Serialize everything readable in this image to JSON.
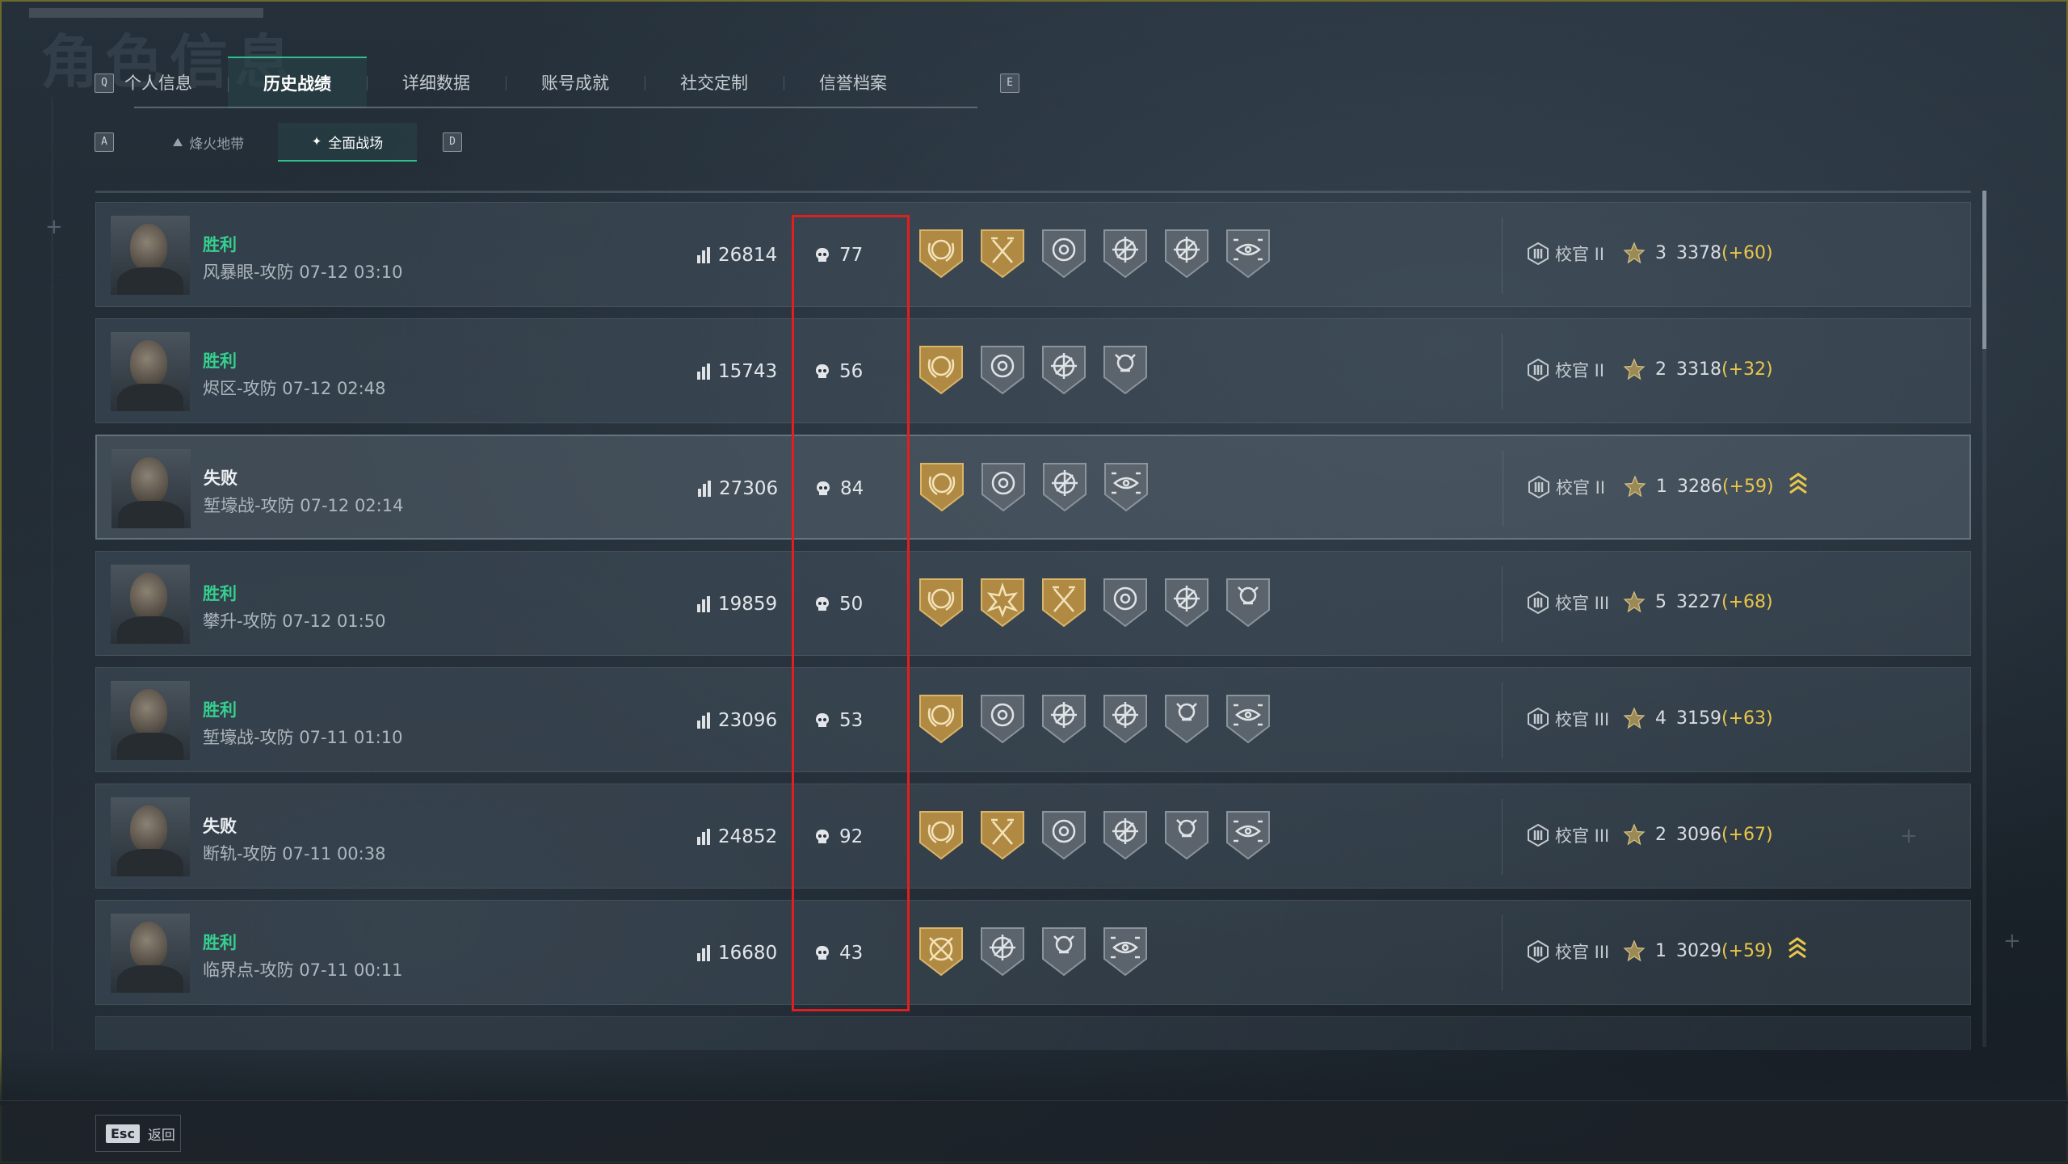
{
  "page_title_bg": "角色信息",
  "keys": {
    "left_tab": "Q",
    "right_tab": "E",
    "left_sub": "A",
    "right_sub": "D"
  },
  "tabs": [
    {
      "label": "个人信息",
      "active": false
    },
    {
      "label": "历史战绩",
      "active": true
    },
    {
      "label": "详细数据",
      "active": false
    },
    {
      "label": "账号成就",
      "active": false
    },
    {
      "label": "社交定制",
      "active": false
    },
    {
      "label": "信誉档案",
      "active": false
    }
  ],
  "subtabs": [
    {
      "label": "烽火地带",
      "icon": "fire-zone-icon",
      "active": false
    },
    {
      "label": "全面战场",
      "icon": "warfare-icon",
      "active": true
    }
  ],
  "matches": [
    {
      "result": "胜利",
      "win": true,
      "map": "风暴眼-攻防 07-12 03:10",
      "score": "26814",
      "kills": "77",
      "medals": [
        "gold-wreath",
        "gold-axes",
        "silver-target",
        "silver-crosshair",
        "silver-crosshair",
        "silver-eye"
      ],
      "rank": "校官 II",
      "stars": "3",
      "points": "3378",
      "delta": "(+60)",
      "promoted": false,
      "highlight": false
    },
    {
      "result": "胜利",
      "win": true,
      "map": "烬区-攻防 07-12 02:48",
      "score": "15743",
      "kills": "56",
      "medals": [
        "gold-wreath",
        "silver-target",
        "silver-crosshair",
        "silver-skull"
      ],
      "rank": "校官 II",
      "stars": "2",
      "points": "3318",
      "delta": "(+32)",
      "promoted": false,
      "highlight": false
    },
    {
      "result": "失败",
      "win": false,
      "map": "堑壕战-攻防 07-12 02:14",
      "score": "27306",
      "kills": "84",
      "medals": [
        "gold-wreath",
        "silver-target",
        "silver-crosshair",
        "silver-eye"
      ],
      "rank": "校官 II",
      "stars": "1",
      "points": "3286",
      "delta": "(+59)",
      "promoted": true,
      "highlight": true
    },
    {
      "result": "胜利",
      "win": true,
      "map": "攀升-攻防 07-12 01:50",
      "score": "19859",
      "kills": "50",
      "medals": [
        "gold-wreath",
        "gold-burst",
        "gold-axes",
        "silver-target",
        "silver-crosshair",
        "silver-skull"
      ],
      "rank": "校官 III",
      "stars": "5",
      "points": "3227",
      "delta": "(+68)",
      "promoted": false,
      "highlight": false
    },
    {
      "result": "胜利",
      "win": true,
      "map": "堑壕战-攻防 07-11 01:10",
      "score": "23096",
      "kills": "53",
      "medals": [
        "gold-wreath",
        "silver-target",
        "silver-crosshair",
        "silver-crosshair",
        "silver-skull",
        "silver-eye"
      ],
      "rank": "校官 III",
      "stars": "4",
      "points": "3159",
      "delta": "(+63)",
      "promoted": false,
      "highlight": false
    },
    {
      "result": "失败",
      "win": false,
      "map": "断轨-攻防 07-11 00:38",
      "score": "24852",
      "kills": "92",
      "medals": [
        "gold-wreath",
        "gold-axes",
        "silver-target",
        "silver-crosshair",
        "silver-skull",
        "silver-eye"
      ],
      "rank": "校官 III",
      "stars": "2",
      "points": "3096",
      "delta": "(+67)",
      "promoted": false,
      "highlight": false
    },
    {
      "result": "胜利",
      "win": true,
      "map": "临界点-攻防 07-11 00:11",
      "score": "16680",
      "kills": "43",
      "medals": [
        "gold-swords",
        "silver-crosshair",
        "silver-skull",
        "silver-eye"
      ],
      "rank": "校官 III",
      "stars": "1",
      "points": "3029",
      "delta": "(+59)",
      "promoted": true,
      "highlight": false
    }
  ],
  "footer": {
    "esc_key": "Esc",
    "esc_label": "返回"
  },
  "colors": {
    "win": "#35d08f",
    "loss": "#eef1f3",
    "accent": "#2fbf8f",
    "delta": "#e9c64a",
    "gold_medal": "#b08a43",
    "silver_medal": "#5b646c",
    "highlight_box": "#e21e1e"
  }
}
